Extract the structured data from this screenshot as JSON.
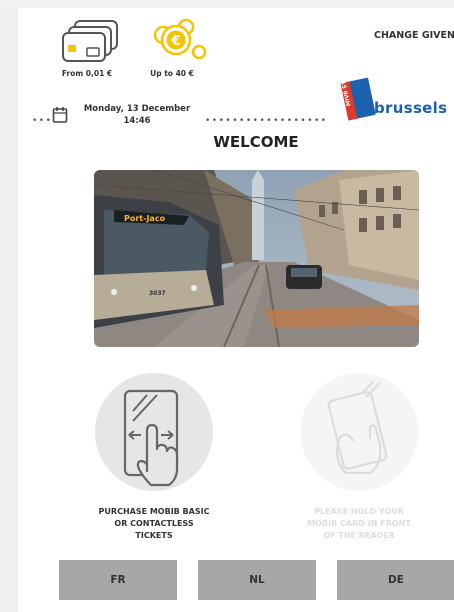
{
  "payment": {
    "card_label": "From 0,01 €",
    "coins_label": "Up to 40 €",
    "change_text": "CHANGE GIVEN"
  },
  "datetime": {
    "date": "Monday, 13 December",
    "time": "14:46"
  },
  "brand": {
    "logo_text": "MIVB STIB",
    "name": ".brussels"
  },
  "welcome_title": "WELCOME",
  "options": [
    {
      "caption_lines": [
        "PURCHASE MOBIB BASIC",
        "OR CONTACTLESS",
        "TICKETS"
      ],
      "enabled": true
    },
    {
      "caption_lines": [
        "PLEASE HOLD YOUR",
        "MOBIB CARD IN FRONT",
        "OF THE READER"
      ],
      "enabled": false
    }
  ],
  "languages": [
    "FR",
    "NL",
    "DE"
  ],
  "photo": {
    "tram_destination": "Port-Jaco",
    "tram_number": "3037"
  },
  "colors": {
    "accent_yellow": "#f5c400",
    "brand_blue": "#1d62ad",
    "button_gray": "#a7a7a7"
  }
}
